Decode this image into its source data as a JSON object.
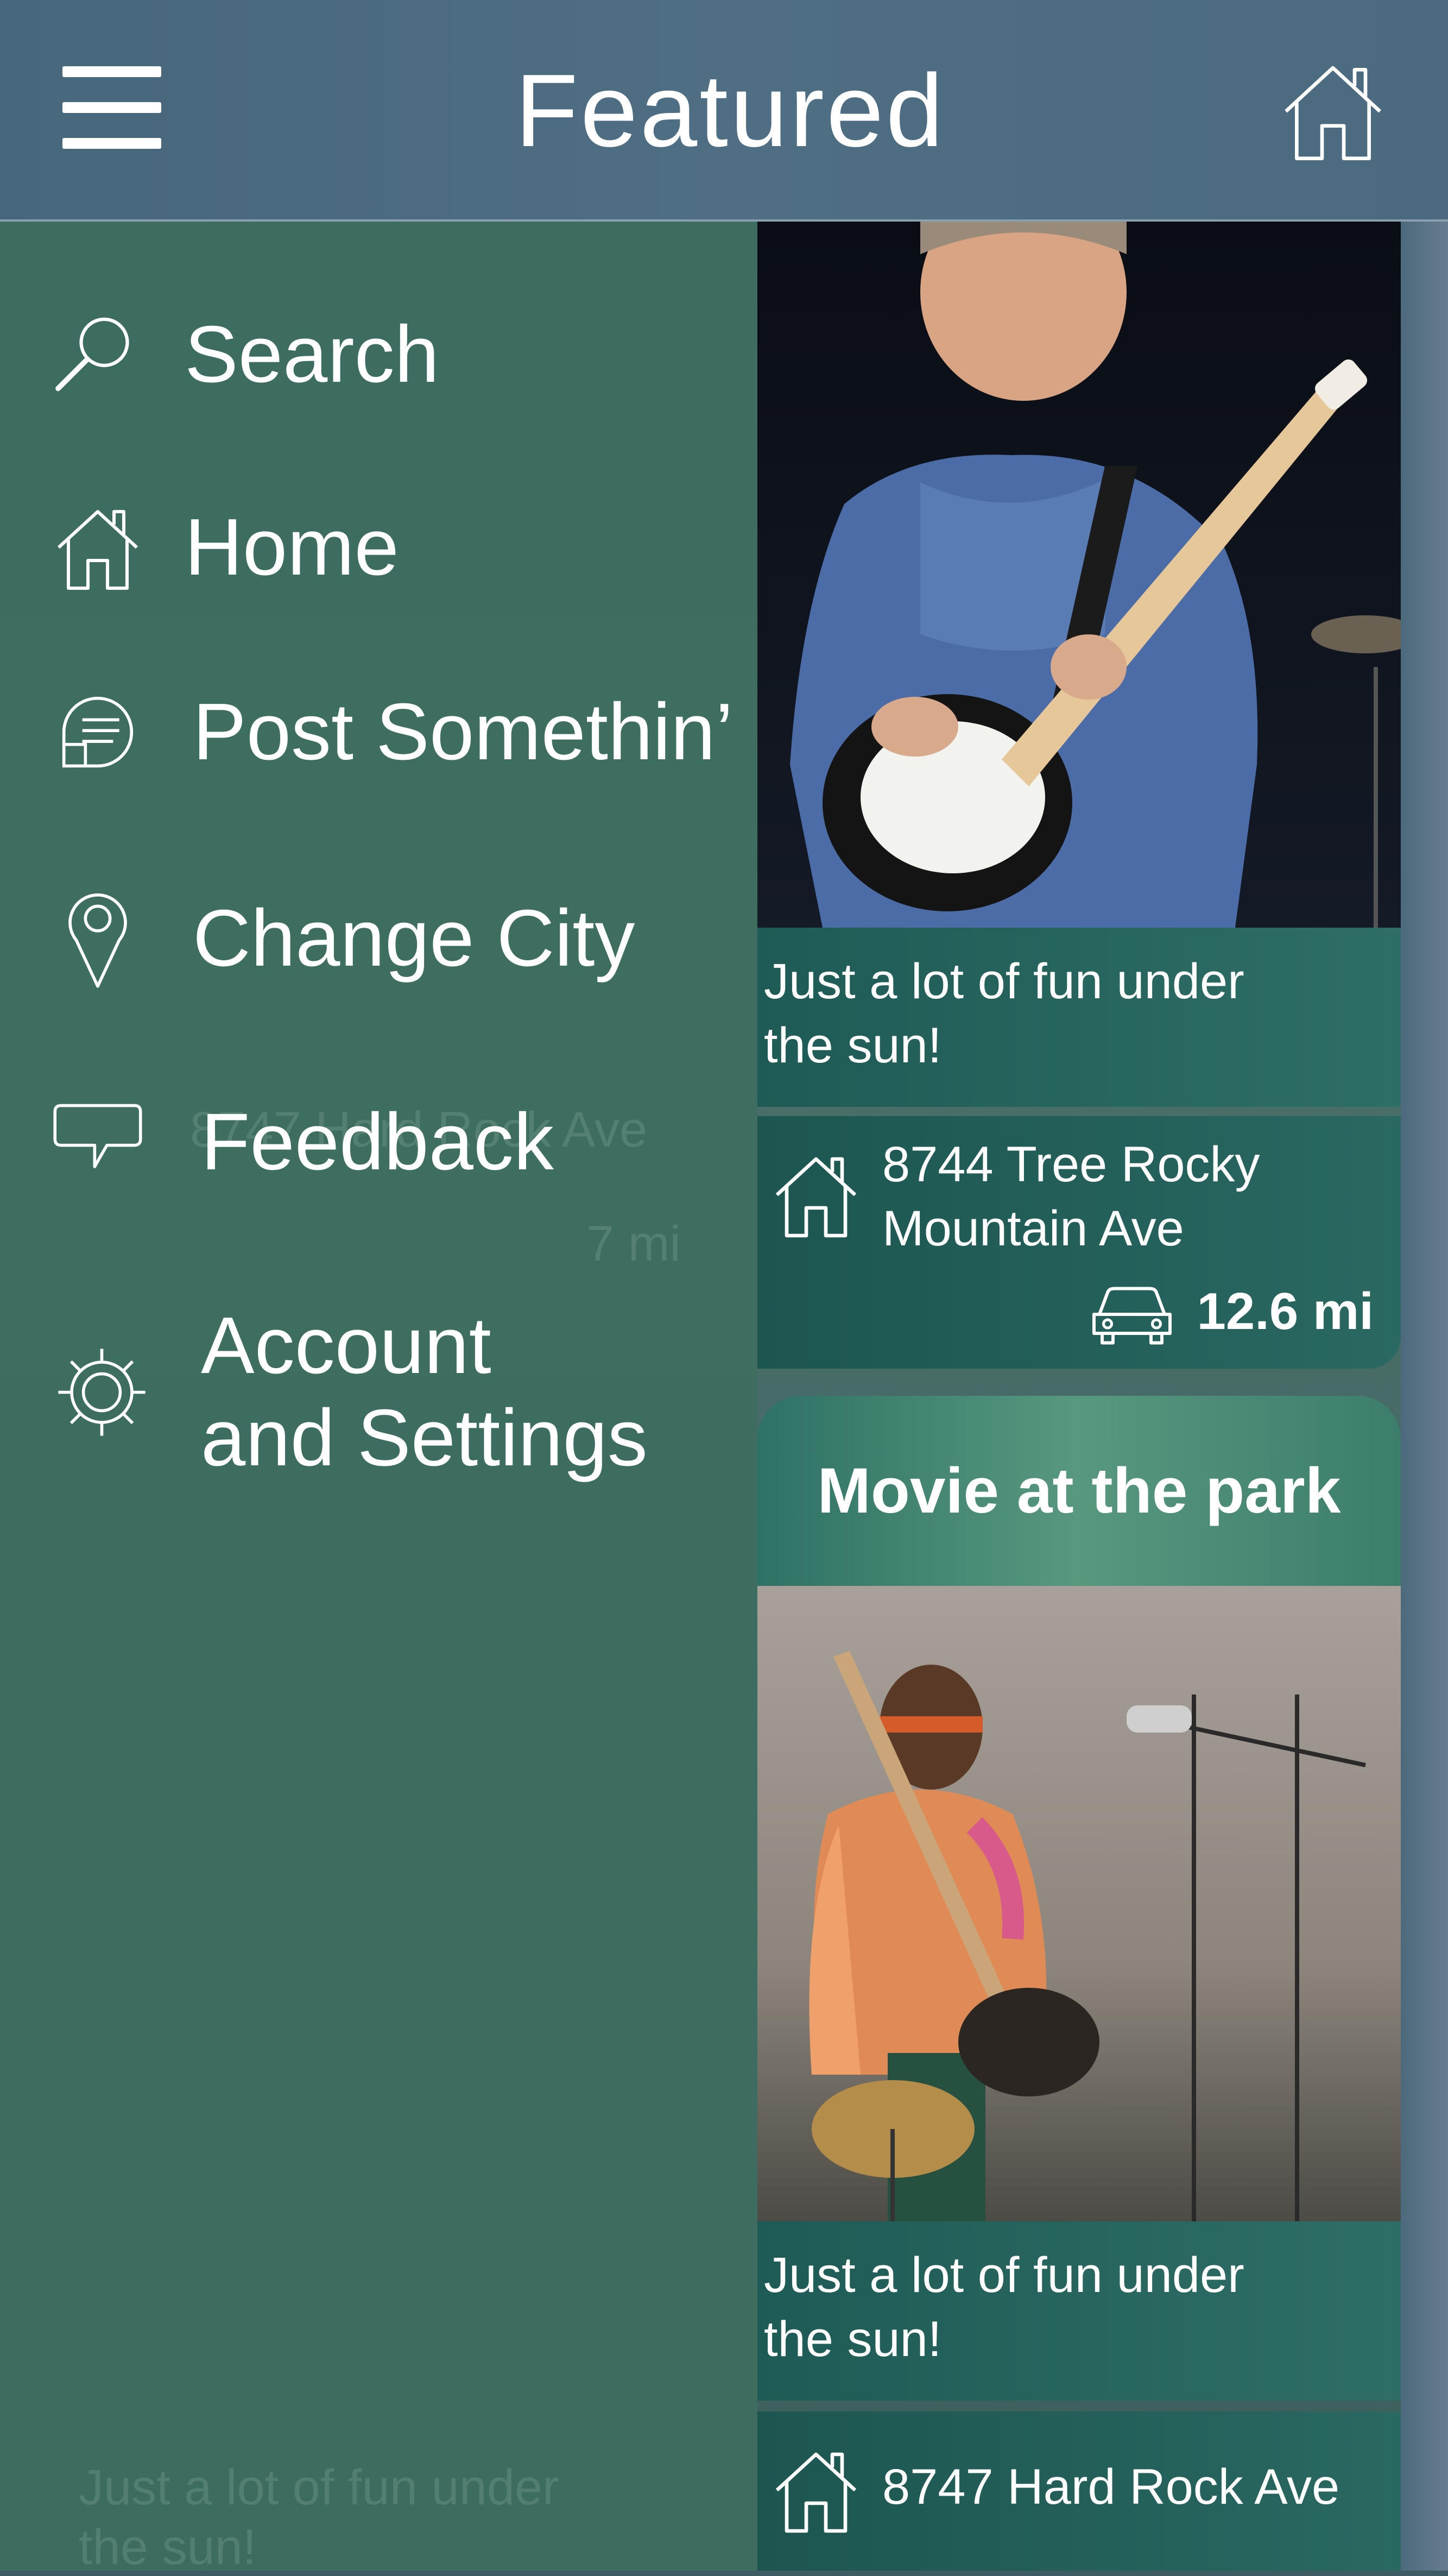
{
  "header": {
    "title": "Featured"
  },
  "menu": {
    "items": [
      {
        "label": "Search",
        "icon": "search-icon"
      },
      {
        "label": "Home",
        "icon": "home-icon"
      },
      {
        "label": "Post Somethin’",
        "icon": "post-icon"
      },
      {
        "label": "Change City",
        "icon": "location-pin-icon"
      },
      {
        "label": "Feedback",
        "icon": "speech-bubble-icon"
      },
      {
        "label_line1": "Account",
        "label_line2": "and Settings",
        "icon": "gear-icon"
      }
    ]
  },
  "feed": {
    "card1": {
      "description_line1": "Just a lot of fun under",
      "description_line2": " the sun!",
      "address_line1": "8744 Tree Rocky",
      "address_line2": "Mountain Ave",
      "distance": "12.6 mi"
    },
    "card2": {
      "title": "Movie at the park",
      "description_line1": "Just a lot of fun under",
      "description_line2": " the sun!",
      "address": "8747 Hard Rock Ave"
    }
  },
  "behind": {
    "ghost_address": "8747 Hard Rock Ave",
    "ghost_distance": "7 mi",
    "ghost_desc_line1": "Just a lot of fun under",
    "ghost_desc_line2": "the sun!"
  },
  "colors": {
    "header": "#4b6a80",
    "drawer": "#3c6e60",
    "card": "#2a6862",
    "text": "#ffffff"
  }
}
